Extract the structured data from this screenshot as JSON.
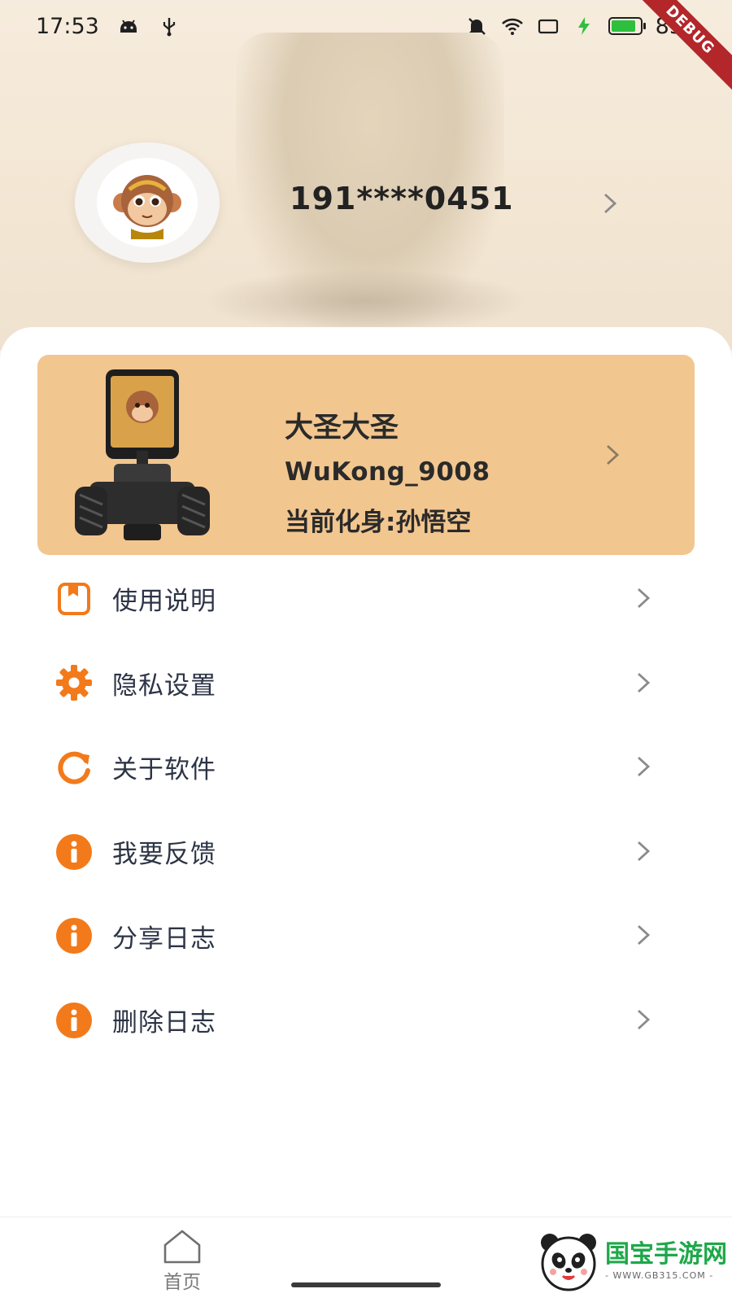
{
  "status_bar": {
    "time": "17:53",
    "battery": "85",
    "debug_label": "DEBUG",
    "icons": [
      "android-icon",
      "usb-icon",
      "mute-icon",
      "wifi-icon",
      "cast-icon",
      "charging-icon",
      "battery-icon"
    ]
  },
  "profile": {
    "phone": "191****0451",
    "avatar_icon": "monkey-avatar"
  },
  "device_card": {
    "name": "大圣大圣",
    "id": "WuKong_9008",
    "avatar_label": "当前化身:孙悟空",
    "background_color": "#f2c68f"
  },
  "menu": {
    "items": [
      {
        "label": "使用说明",
        "icon": "manual-icon"
      },
      {
        "label": "隐私设置",
        "icon": "gear-icon"
      },
      {
        "label": "关于软件",
        "icon": "refresh-icon"
      },
      {
        "label": "我要反馈",
        "icon": "info-icon"
      },
      {
        "label": "分享日志",
        "icon": "info-icon"
      },
      {
        "label": "删除日志",
        "icon": "info-icon"
      }
    ],
    "accent_color": "#f27a1a"
  },
  "bottom_nav": {
    "home_label": "首页"
  },
  "watermark": {
    "title": "国宝手游网",
    "url": "- WWW.GB315.COM -"
  }
}
